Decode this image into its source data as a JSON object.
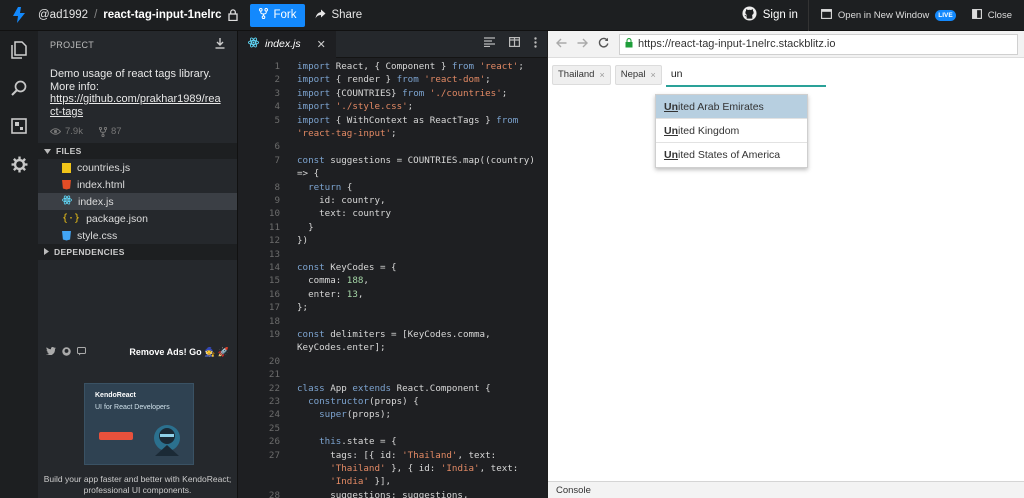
{
  "header": {
    "user": "@ad1992",
    "separator": "/",
    "repo": "react-tag-input-1nelrc",
    "fork_label": "Fork",
    "share_label": "Share",
    "signin_label": "Sign in",
    "newwin_label": "Open in New Window",
    "live_badge": "LIVE",
    "close_label": "Close"
  },
  "sidebar": {
    "project_label": "PROJECT",
    "description": "Demo usage of react tags library. More info:",
    "link": "https://github.com/prakhar1989/react-tags",
    "views": "7.9k",
    "likes": "87",
    "files_label": "FILES",
    "files": [
      {
        "name": "countries.js",
        "icon": "js-file-icon",
        "color": "#f0c419"
      },
      {
        "name": "index.html",
        "icon": "html-file-icon",
        "color": "#e44d26"
      },
      {
        "name": "index.js",
        "icon": "react-file-icon",
        "color": "#61dafb"
      },
      {
        "name": "package.json",
        "icon": "json-file-icon",
        "color": "#f0c419"
      },
      {
        "name": "style.css",
        "icon": "css-file-icon",
        "color": "#42a5f5"
      }
    ],
    "dependencies_label": "DEPENDENCIES",
    "remove_ads": "Remove Ads! Go 🧙 🚀",
    "ad_title": "KendoReact",
    "ad_subtitle": "UI for React Developers",
    "ad_caption": "Build your app faster and better with KendoReact; professional UI components."
  },
  "editor": {
    "tab": "index.js",
    "lines": [
      {
        "n": "1",
        "t": "import React, { Component } from 'react';"
      },
      {
        "n": "2",
        "t": "import { render } from 'react-dom';"
      },
      {
        "n": "3",
        "t": "import {COUNTRIES} from './countries';"
      },
      {
        "n": "4",
        "t": "import './style.css';"
      },
      {
        "n": "5",
        "t": "import { WithContext as ReactTags } from"
      },
      {
        "n": "",
        "t": "'react-tag-input';"
      },
      {
        "n": "6",
        "t": ""
      },
      {
        "n": "7",
        "t": "const suggestions = COUNTRIES.map((country)"
      },
      {
        "n": "",
        "t": "=> {"
      },
      {
        "n": "8",
        "t": "  return {"
      },
      {
        "n": "9",
        "t": "    id: country,"
      },
      {
        "n": "10",
        "t": "    text: country"
      },
      {
        "n": "11",
        "t": "  }"
      },
      {
        "n": "12",
        "t": "})"
      },
      {
        "n": "13",
        "t": ""
      },
      {
        "n": "14",
        "t": "const KeyCodes = {"
      },
      {
        "n": "15",
        "t": "  comma: 188,"
      },
      {
        "n": "16",
        "t": "  enter: 13,"
      },
      {
        "n": "17",
        "t": "};"
      },
      {
        "n": "18",
        "t": ""
      },
      {
        "n": "19",
        "t": "const delimiters = [KeyCodes.comma,"
      },
      {
        "n": "",
        "t": "KeyCodes.enter];"
      },
      {
        "n": "20",
        "t": ""
      },
      {
        "n": "21",
        "t": ""
      },
      {
        "n": "22",
        "t": "class App extends React.Component {"
      },
      {
        "n": "23",
        "t": "  constructor(props) {"
      },
      {
        "n": "24",
        "t": "    super(props);"
      },
      {
        "n": "25",
        "t": ""
      },
      {
        "n": "26",
        "t": "    this.state = {"
      },
      {
        "n": "27",
        "t": "      tags: [{ id: 'Thailand', text:"
      },
      {
        "n": "",
        "t": "      'Thailand' }, { id: 'India', text:"
      },
      {
        "n": "",
        "t": "      'India' }],"
      },
      {
        "n": "28",
        "t": "      suggestions: suggestions,"
      }
    ]
  },
  "preview": {
    "url": "https://react-tag-input-1nelrc.stackblitz.io",
    "tags": [
      {
        "label": "Thailand",
        "remove": "×"
      },
      {
        "label": "Nepal",
        "remove": "×"
      }
    ],
    "input_value": "un",
    "suggestions": [
      {
        "match": "Un",
        "rest": "ited Arab Emirates"
      },
      {
        "match": "Un",
        "rest": "ited Kingdom"
      },
      {
        "match": "Un",
        "rest": "ited States of America"
      }
    ],
    "console_label": "Console"
  },
  "colors": {
    "accent": "#1389fd",
    "input_underline": "#2aa198",
    "active_suggestion": "#b7cfe0"
  }
}
